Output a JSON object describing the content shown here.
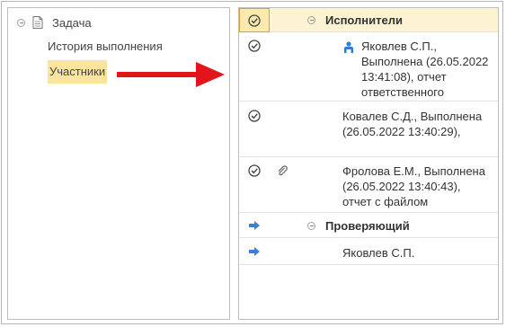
{
  "tree": {
    "root_label": "Задача",
    "items": [
      {
        "label": "История выполнения"
      },
      {
        "label": "Участники"
      }
    ]
  },
  "grid": {
    "groups": [
      {
        "label": "Исполнители"
      },
      {
        "label": "Проверяющий"
      }
    ],
    "rows": [
      {
        "text": "Яковлев С.П.,\nВыполнена (26.05.2022\n13:41:08),  отчет\n ответственного"
      },
      {
        "text": "Ковалев С.Д., Выполнена\n(26.05.2022 13:40:29),"
      },
      {
        "text": "Фролова Е.М., Выполнена\n(26.05.2022 13:40:43),\n отчет с файлом"
      },
      {
        "text": "Яковлев С.П."
      }
    ]
  },
  "colors": {
    "selection": "#fbe49c",
    "group_header": "#fcf3d2",
    "arrow": "#e3151a",
    "blue_arrow": "#3b7fd6"
  },
  "icons": [
    "collapse-icon",
    "document-icon",
    "red-arrow-icon",
    "check-icon",
    "paperclip-icon",
    "person-icon",
    "blue-arrow-icon"
  ]
}
